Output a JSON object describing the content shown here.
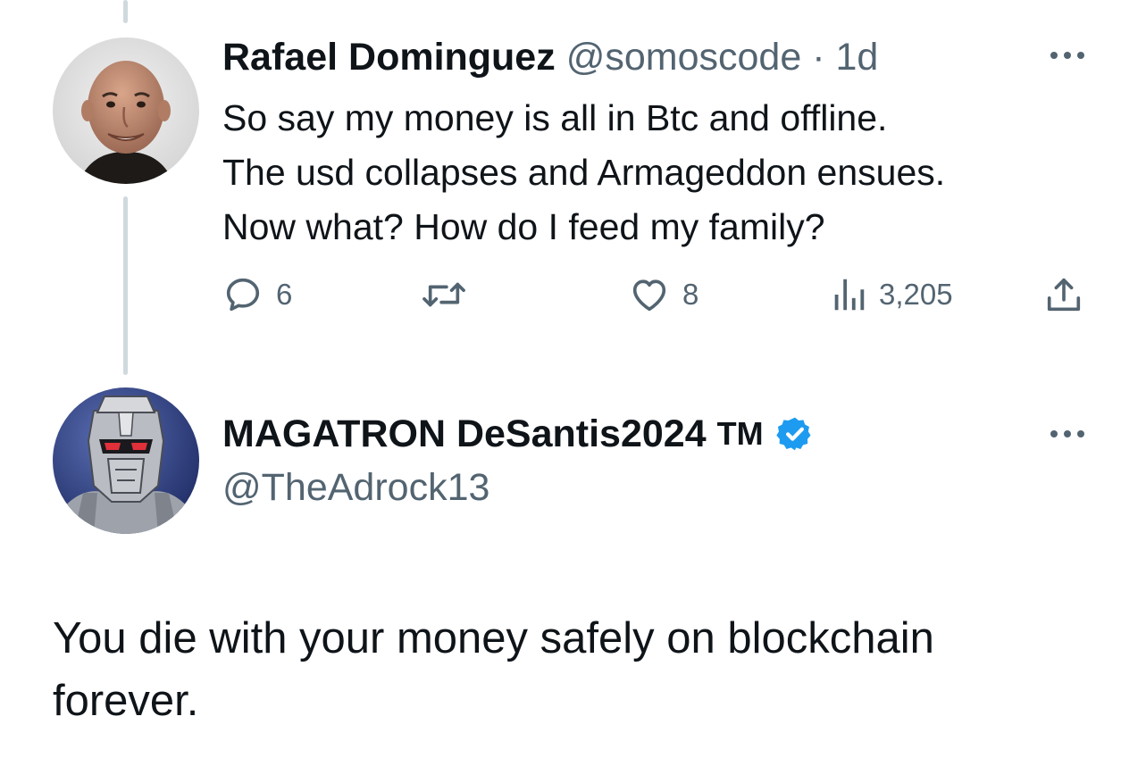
{
  "tweet1": {
    "display_name": "Rafael Dominguez",
    "handle": "@somoscode",
    "separator": "·",
    "timestamp": "1d",
    "text_lines": [
      "So say my money is all in Btc and offline.",
      "The usd collapses and Armageddon ensues.",
      "Now what? How do I feed my family?"
    ],
    "actions": {
      "replies": "6",
      "likes": "8",
      "views": "3,205"
    },
    "avatar_icon": "person-photo-avatar"
  },
  "tweet2": {
    "display_name": "MAGATRON DeSantis2024",
    "name_suffix": "TM",
    "handle": "@TheAdrock13",
    "verified": true,
    "text_lines": [
      "You die with your money safely on blockchain",
      "forever."
    ],
    "avatar_icon": "robot-avatar"
  },
  "colors": {
    "primary_text": "#0f1419",
    "secondary_text": "#536471",
    "verified_blue": "#1d9bf0",
    "thread_line": "#cfd9de"
  },
  "icons": {
    "reply": "reply-icon",
    "retweet": "retweet-icon",
    "like": "heart-icon",
    "views": "views-icon",
    "share": "share-icon",
    "more": "more-icon",
    "verified": "verified-badge-icon"
  }
}
